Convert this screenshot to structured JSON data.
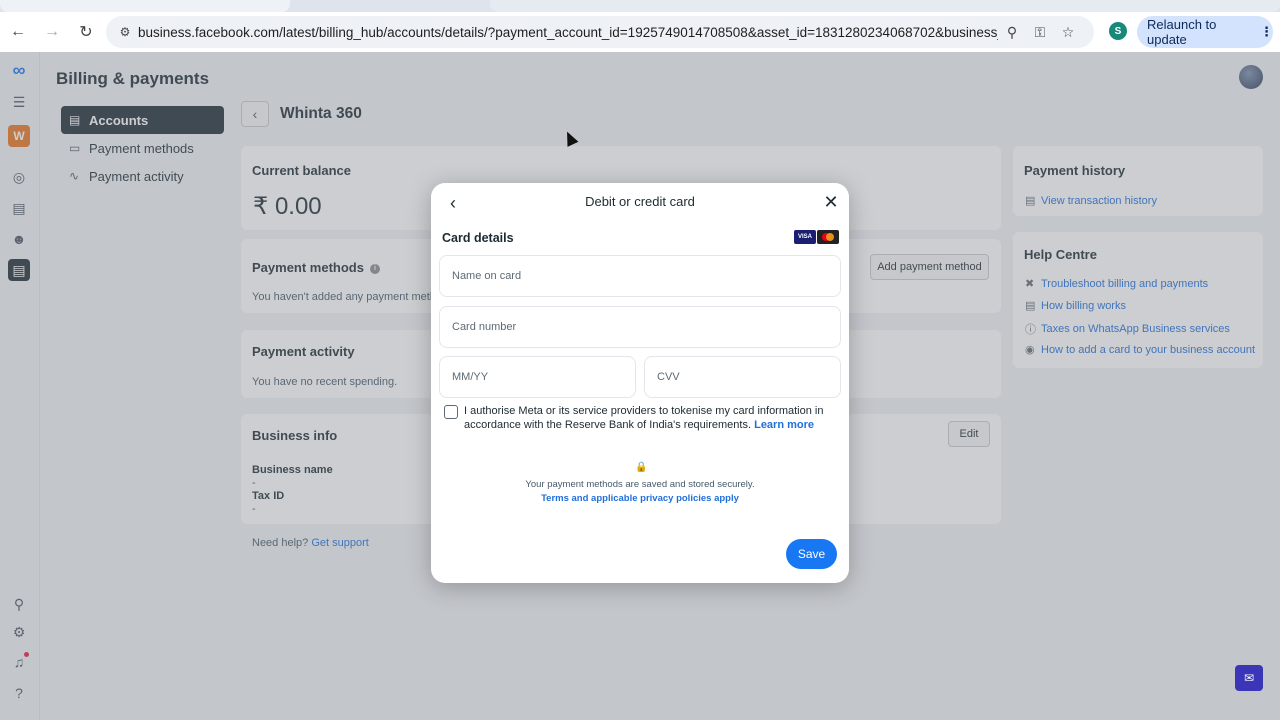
{
  "browser": {
    "url": "business.facebook.com/latest/billing_hub/accounts/details/?payment_account_id=1925749014708508&asset_id=1831280234068702&business_id...",
    "profile_initial": "S",
    "relaunch_label": "Relaunch to update"
  },
  "app": {
    "page_title": "Billing & payments",
    "rail_icons": [
      "meta-logo",
      "menu-icon",
      "workspace-w",
      "compass-icon",
      "pages-icon",
      "people-icon",
      "billing-icon",
      "search-icon",
      "settings-icon",
      "notifications-icon",
      "help-icon"
    ],
    "workspace_letter": "W"
  },
  "subnav": {
    "items": [
      {
        "label": "Accounts",
        "icon": "accounts-icon",
        "active": true
      },
      {
        "label": "Payment methods",
        "icon": "card-icon",
        "active": false
      },
      {
        "label": "Payment activity",
        "icon": "activity-icon",
        "active": false
      }
    ]
  },
  "account": {
    "name": "Whinta 360"
  },
  "balance_card": {
    "title": "Current balance",
    "amount": "₹ 0.00"
  },
  "payment_methods_card": {
    "title": "Payment methods",
    "empty_text": "You haven't added any payment method",
    "add_button": "Add payment method"
  },
  "payment_activity_card": {
    "title": "Payment activity",
    "empty_text": "You have no recent spending."
  },
  "business_info_card": {
    "title": "Business info",
    "edit_button": "Edit",
    "business_name_label": "Business name",
    "business_name_value": "-",
    "tax_id_label": "Tax ID",
    "tax_id_value": "-"
  },
  "help_line": {
    "prefix": "Need help?",
    "link": "Get support"
  },
  "payment_history": {
    "title": "Payment history",
    "link": "View transaction history"
  },
  "help_centre": {
    "title": "Help Centre",
    "links": [
      "Troubleshoot billing and payments",
      "How billing works",
      "Taxes on WhatsApp Business services",
      "How to add a card to your business account"
    ]
  },
  "modal": {
    "title": "Debit or credit card",
    "section_title": "Card details",
    "card_brands": [
      "VISA",
      "Mastercard"
    ],
    "name_placeholder": "Name on card",
    "number_placeholder": "Card number",
    "expiry_placeholder": "MM/YY",
    "cvv_placeholder": "CVV",
    "consent_text": "I authorise Meta or its service providers to tokenise my card information in accordance with the Reserve Bank of India's requirements.",
    "consent_link": "Learn more",
    "secure_text": "Your payment methods are saved and stored securely.",
    "terms_link": "Terms and applicable privacy policies apply",
    "save_button": "Save"
  },
  "colors": {
    "accent": "#1877f2",
    "link": "#216fdb",
    "dark": "#1c2b33"
  }
}
